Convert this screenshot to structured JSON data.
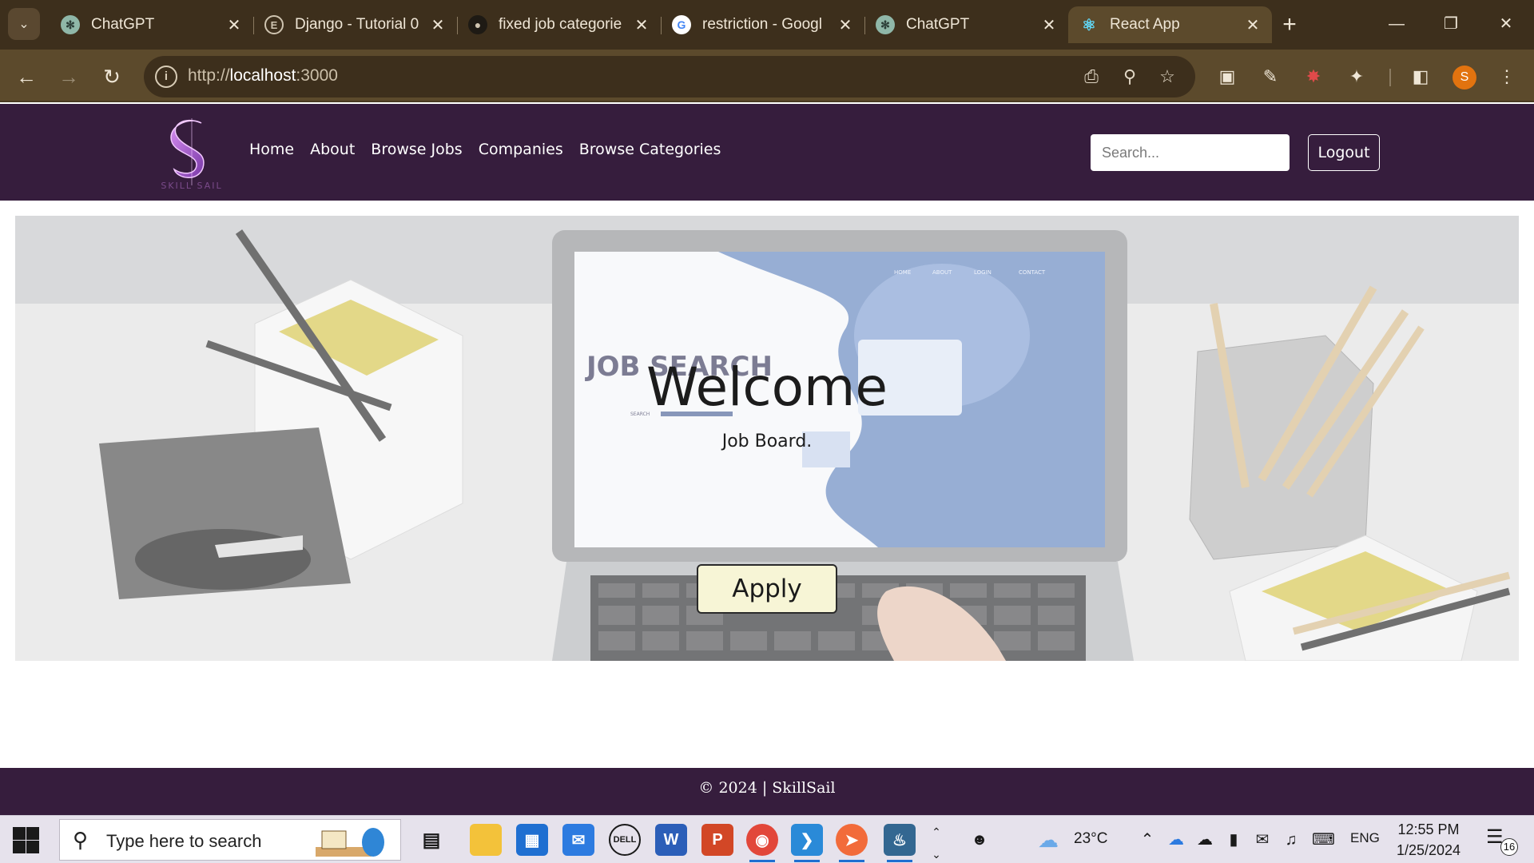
{
  "browser": {
    "tabs": [
      {
        "title": "ChatGPT",
        "icon": "chatgpt-icon",
        "active": false
      },
      {
        "title": "Django - Tutorial 0",
        "icon": "django-e-icon",
        "active": false
      },
      {
        "title": "fixed job categorie",
        "icon": "github-icon",
        "active": false
      },
      {
        "title": "restriction - Googl",
        "icon": "google-icon",
        "active": false
      },
      {
        "title": "ChatGPT",
        "icon": "chatgpt-icon",
        "active": false
      },
      {
        "title": "React App",
        "icon": "react-icon",
        "active": true
      }
    ],
    "url_scheme": "http://",
    "url_host": "localhost",
    "url_port": ":3000",
    "profile_initial": "S",
    "theme_color": "#5c4a2c"
  },
  "app": {
    "brand_color": "#361d3d",
    "nav": {
      "links": [
        "Home",
        "About",
        "Browse Jobs",
        "Companies",
        "Browse Categories"
      ],
      "search_placeholder": "Search...",
      "logout_label": "Logout"
    },
    "hero": {
      "title": "Welcome",
      "subtitle": "Job Board.",
      "apply_label": "Apply",
      "image_text": {
        "laptop_heading": "JOB SEARCH",
        "laptop_nav": [
          "HOME",
          "ABOUT",
          "LOGIN",
          "CONTACT"
        ],
        "laptop_search_label": "SEARCH"
      }
    },
    "footer": {
      "text": "© 2024 | SkillSail"
    }
  },
  "taskbar": {
    "search_placeholder": "Type here to search",
    "weather": "23°C",
    "language": "ENG",
    "time": "12:55 PM",
    "date": "1/25/2024",
    "notification_count": "16"
  }
}
